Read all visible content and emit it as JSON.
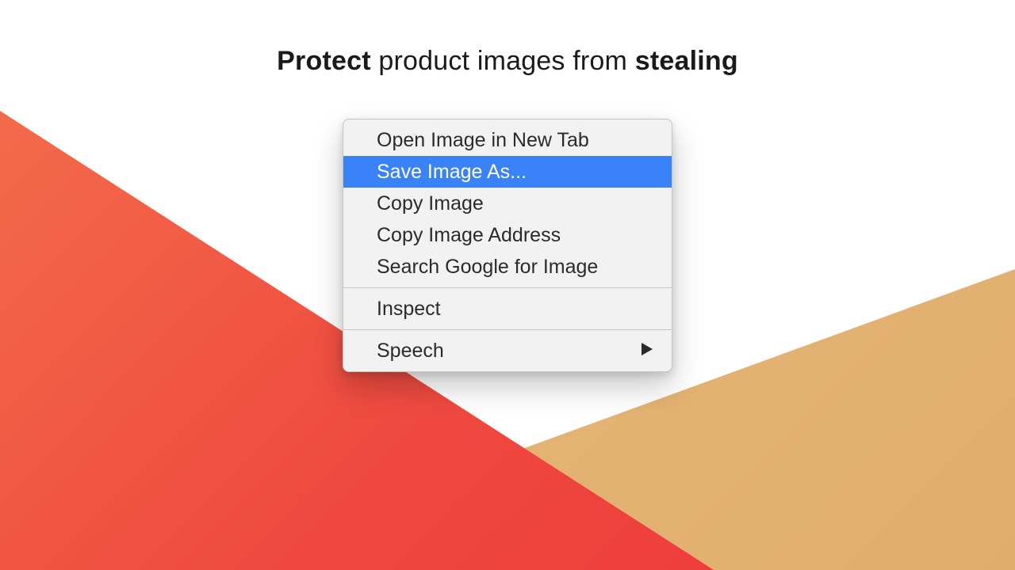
{
  "headline": {
    "w1": "Protect",
    "mid": " product images from ",
    "w2": "stealing"
  },
  "menu": {
    "items": [
      "Open Image in New Tab",
      "Save Image As...",
      "Copy Image",
      "Copy Image Address",
      "Search Google for Image"
    ],
    "inspect": "Inspect",
    "speech": "Speech",
    "highlight_index": 1
  },
  "colors": {
    "red_gradient_from": "#f36b4a",
    "red_gradient_to": "#ee3e3c",
    "tan_gradient_from": "#e6b87a",
    "tan_gradient_to": "#e1ad6c",
    "highlight": "#3a82f7"
  }
}
